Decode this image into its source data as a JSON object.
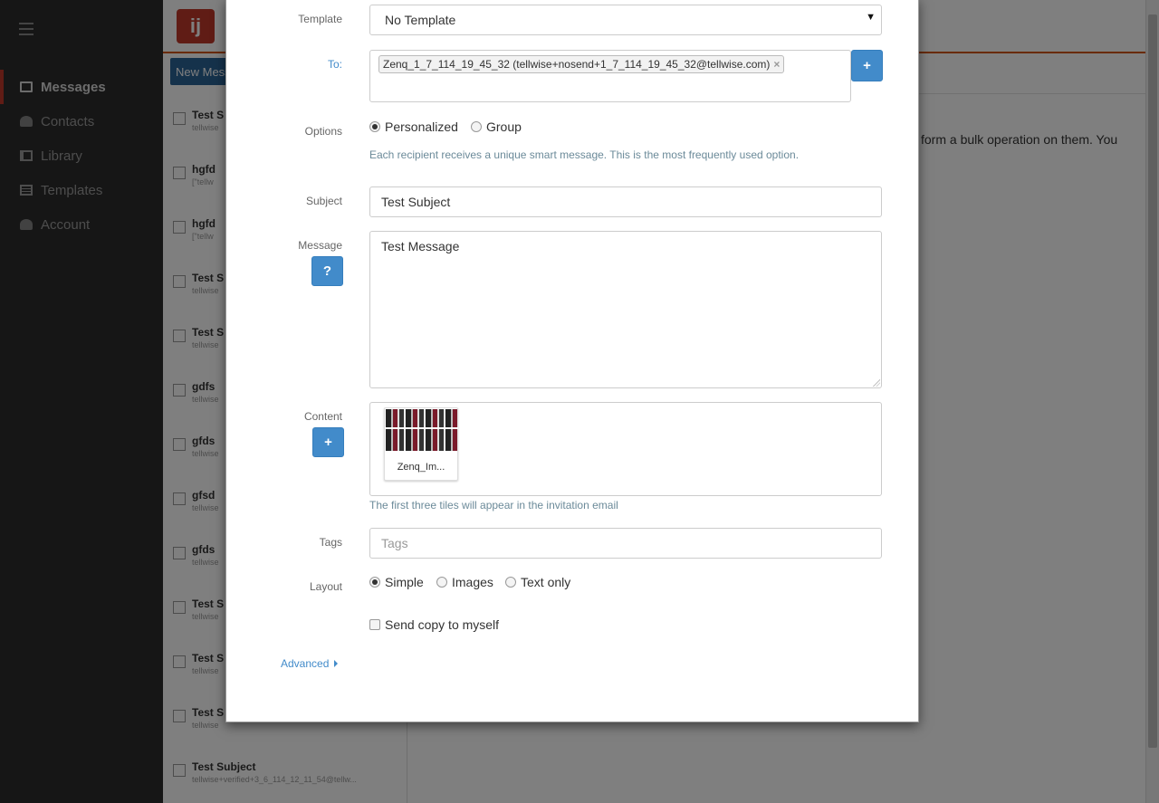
{
  "colors": {
    "accent": "#428bca",
    "brand": "#c0392b",
    "nav_bg": "#2d2d2d"
  },
  "nav": {
    "items": [
      {
        "label": "Messages",
        "icon": "mail-icon",
        "active": true
      },
      {
        "label": "Contacts",
        "icon": "user-icon"
      },
      {
        "label": "Library",
        "icon": "book-icon"
      },
      {
        "label": "Templates",
        "icon": "template-icon"
      },
      {
        "label": "Account",
        "icon": "account-icon"
      }
    ]
  },
  "list": {
    "new_button": "New Mess",
    "rows": [
      {
        "subject": "Test S",
        "sub": "tellwise"
      },
      {
        "subject": "hgfd",
        "sub": "[\"tellw"
      },
      {
        "subject": "hgfd",
        "sub": "[\"tellw"
      },
      {
        "subject": "Test S",
        "sub": "tellwise"
      },
      {
        "subject": "Test S",
        "sub": "tellwise"
      },
      {
        "subject": "gdfs",
        "sub": "tellwise"
      },
      {
        "subject": "gfds",
        "sub": "tellwise"
      },
      {
        "subject": "gfsd",
        "sub": "tellwise"
      },
      {
        "subject": "gfds",
        "sub": "tellwise"
      },
      {
        "subject": "Test S",
        "sub": "tellwise"
      },
      {
        "subject": "Test S",
        "sub": "tellwise"
      },
      {
        "subject": "Test S",
        "sub": "tellwise"
      },
      {
        "subject": "Test Subject",
        "sub": "tellwise+verified+3_6_114_12_11_54@tellw..."
      }
    ]
  },
  "main": {
    "info_text": "form a bulk operation on them. You"
  },
  "modal": {
    "template": {
      "label": "Template",
      "value": "No Template"
    },
    "to": {
      "label": "To:",
      "token": "Zenq_1_7_114_19_45_32 (tellwise+nosend+1_7_114_19_45_32@tellwise.com)",
      "add_label": "+"
    },
    "options": {
      "label": "Options",
      "choices": [
        "Personalized",
        "Group"
      ],
      "selected": "Personalized",
      "help": "Each recipient receives a unique smart message. This is the most frequently used option."
    },
    "subject": {
      "label": "Subject",
      "value": "Test Subject"
    },
    "message": {
      "label": "Message",
      "value": "Test Message",
      "help_button": "?"
    },
    "content": {
      "label": "Content",
      "add_label": "+",
      "tiles": [
        {
          "name": "Zenq_Im..."
        }
      ],
      "help": "The first three tiles will appear in the invitation email"
    },
    "tags": {
      "label": "Tags",
      "placeholder": "Tags"
    },
    "layout": {
      "label": "Layout",
      "choices": [
        "Simple",
        "Images",
        "Text only"
      ],
      "selected": "Simple"
    },
    "send_copy": {
      "label": "Send copy to myself",
      "checked": false
    },
    "advanced": "Advanced"
  }
}
